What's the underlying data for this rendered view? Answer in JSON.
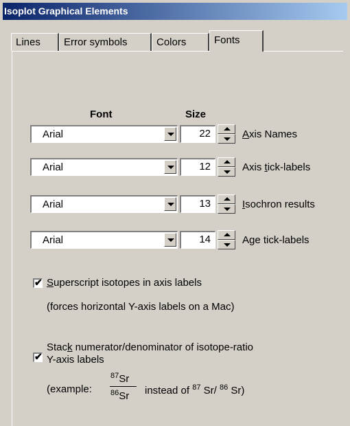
{
  "window": {
    "title": "Isoplot Graphical Elements"
  },
  "tabs": [
    {
      "label": "Lines"
    },
    {
      "label": "Error symbols"
    },
    {
      "label": "Colors"
    },
    {
      "label": "Fonts"
    }
  ],
  "headers": {
    "font": "Font",
    "size": "Size"
  },
  "font_rows": [
    {
      "font": "Arial",
      "size": "22",
      "label_pre": "",
      "label_ul": "A",
      "label_post": "xis Names"
    },
    {
      "font": "Arial",
      "size": "12",
      "label_pre": "Axis ",
      "label_ul": "t",
      "label_post": "ick-labels"
    },
    {
      "font": "Arial",
      "size": "13",
      "label_pre": "",
      "label_ul": "I",
      "label_post": "sochron results"
    },
    {
      "font": "Arial",
      "size": "14",
      "label_pre": "A",
      "label_ul": "g",
      "label_post": "e tick-labels"
    }
  ],
  "options": {
    "superscript": {
      "checked": true,
      "mark": "✔",
      "label_ul": "S",
      "label_post": "uperscript isotopes in axis labels",
      "note": "(forces horizontal Y-axis labels on a Mac)"
    },
    "stack": {
      "checked": true,
      "mark": "✔",
      "label_pre": "Stac",
      "label_ul": "k",
      "label_post": " numerator/denominator of isotope-ratio",
      "label_line2": "Y-axis labels",
      "example_prefix": "(example:",
      "num_sup": "87",
      "num": "Sr",
      "den_sup": "86",
      "den": "Sr",
      "instead": "instead of",
      "inline_sup1": "87",
      "inline_el1": " Sr/",
      "inline_sup2": "86",
      "inline_el2": " Sr)"
    }
  }
}
